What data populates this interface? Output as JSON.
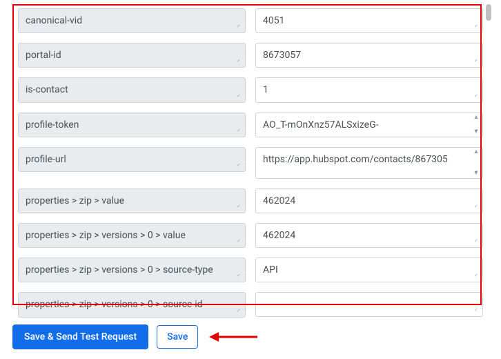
{
  "rows": [
    {
      "key": "canonical-vid",
      "value": "4051",
      "keyResize": true,
      "valType": "single"
    },
    {
      "key": "portal-id",
      "value": "8673057",
      "keyResize": true,
      "valType": "single"
    },
    {
      "key": "is-contact",
      "value": "1",
      "keyResize": true,
      "valType": "single"
    },
    {
      "key": "profile-token",
      "value": "AO_T-mOnXnz57ALSxizeG-",
      "keyResize": true,
      "valType": "multi"
    },
    {
      "key": "profile-url",
      "value": "https://app.hubspot.com/contacts/867305",
      "keyResize": true,
      "valType": "multi-tall"
    },
    {
      "key": "properties > zip > value",
      "value": "462024",
      "keyResize": true,
      "valType": "single"
    },
    {
      "key": "properties > zip > versions > 0 > value",
      "value": "462024",
      "keyResize": true,
      "valType": "single"
    },
    {
      "key": "properties > zip > versions > 0 > source-type",
      "value": "API",
      "keyResize": true,
      "valType": "single"
    },
    {
      "key": "properties > zip > versions > 0 > source-id",
      "value": "",
      "keyResize": true,
      "valType": "single"
    }
  ],
  "buttons": {
    "save_send": "Save & Send Test Request",
    "save": "Save"
  }
}
